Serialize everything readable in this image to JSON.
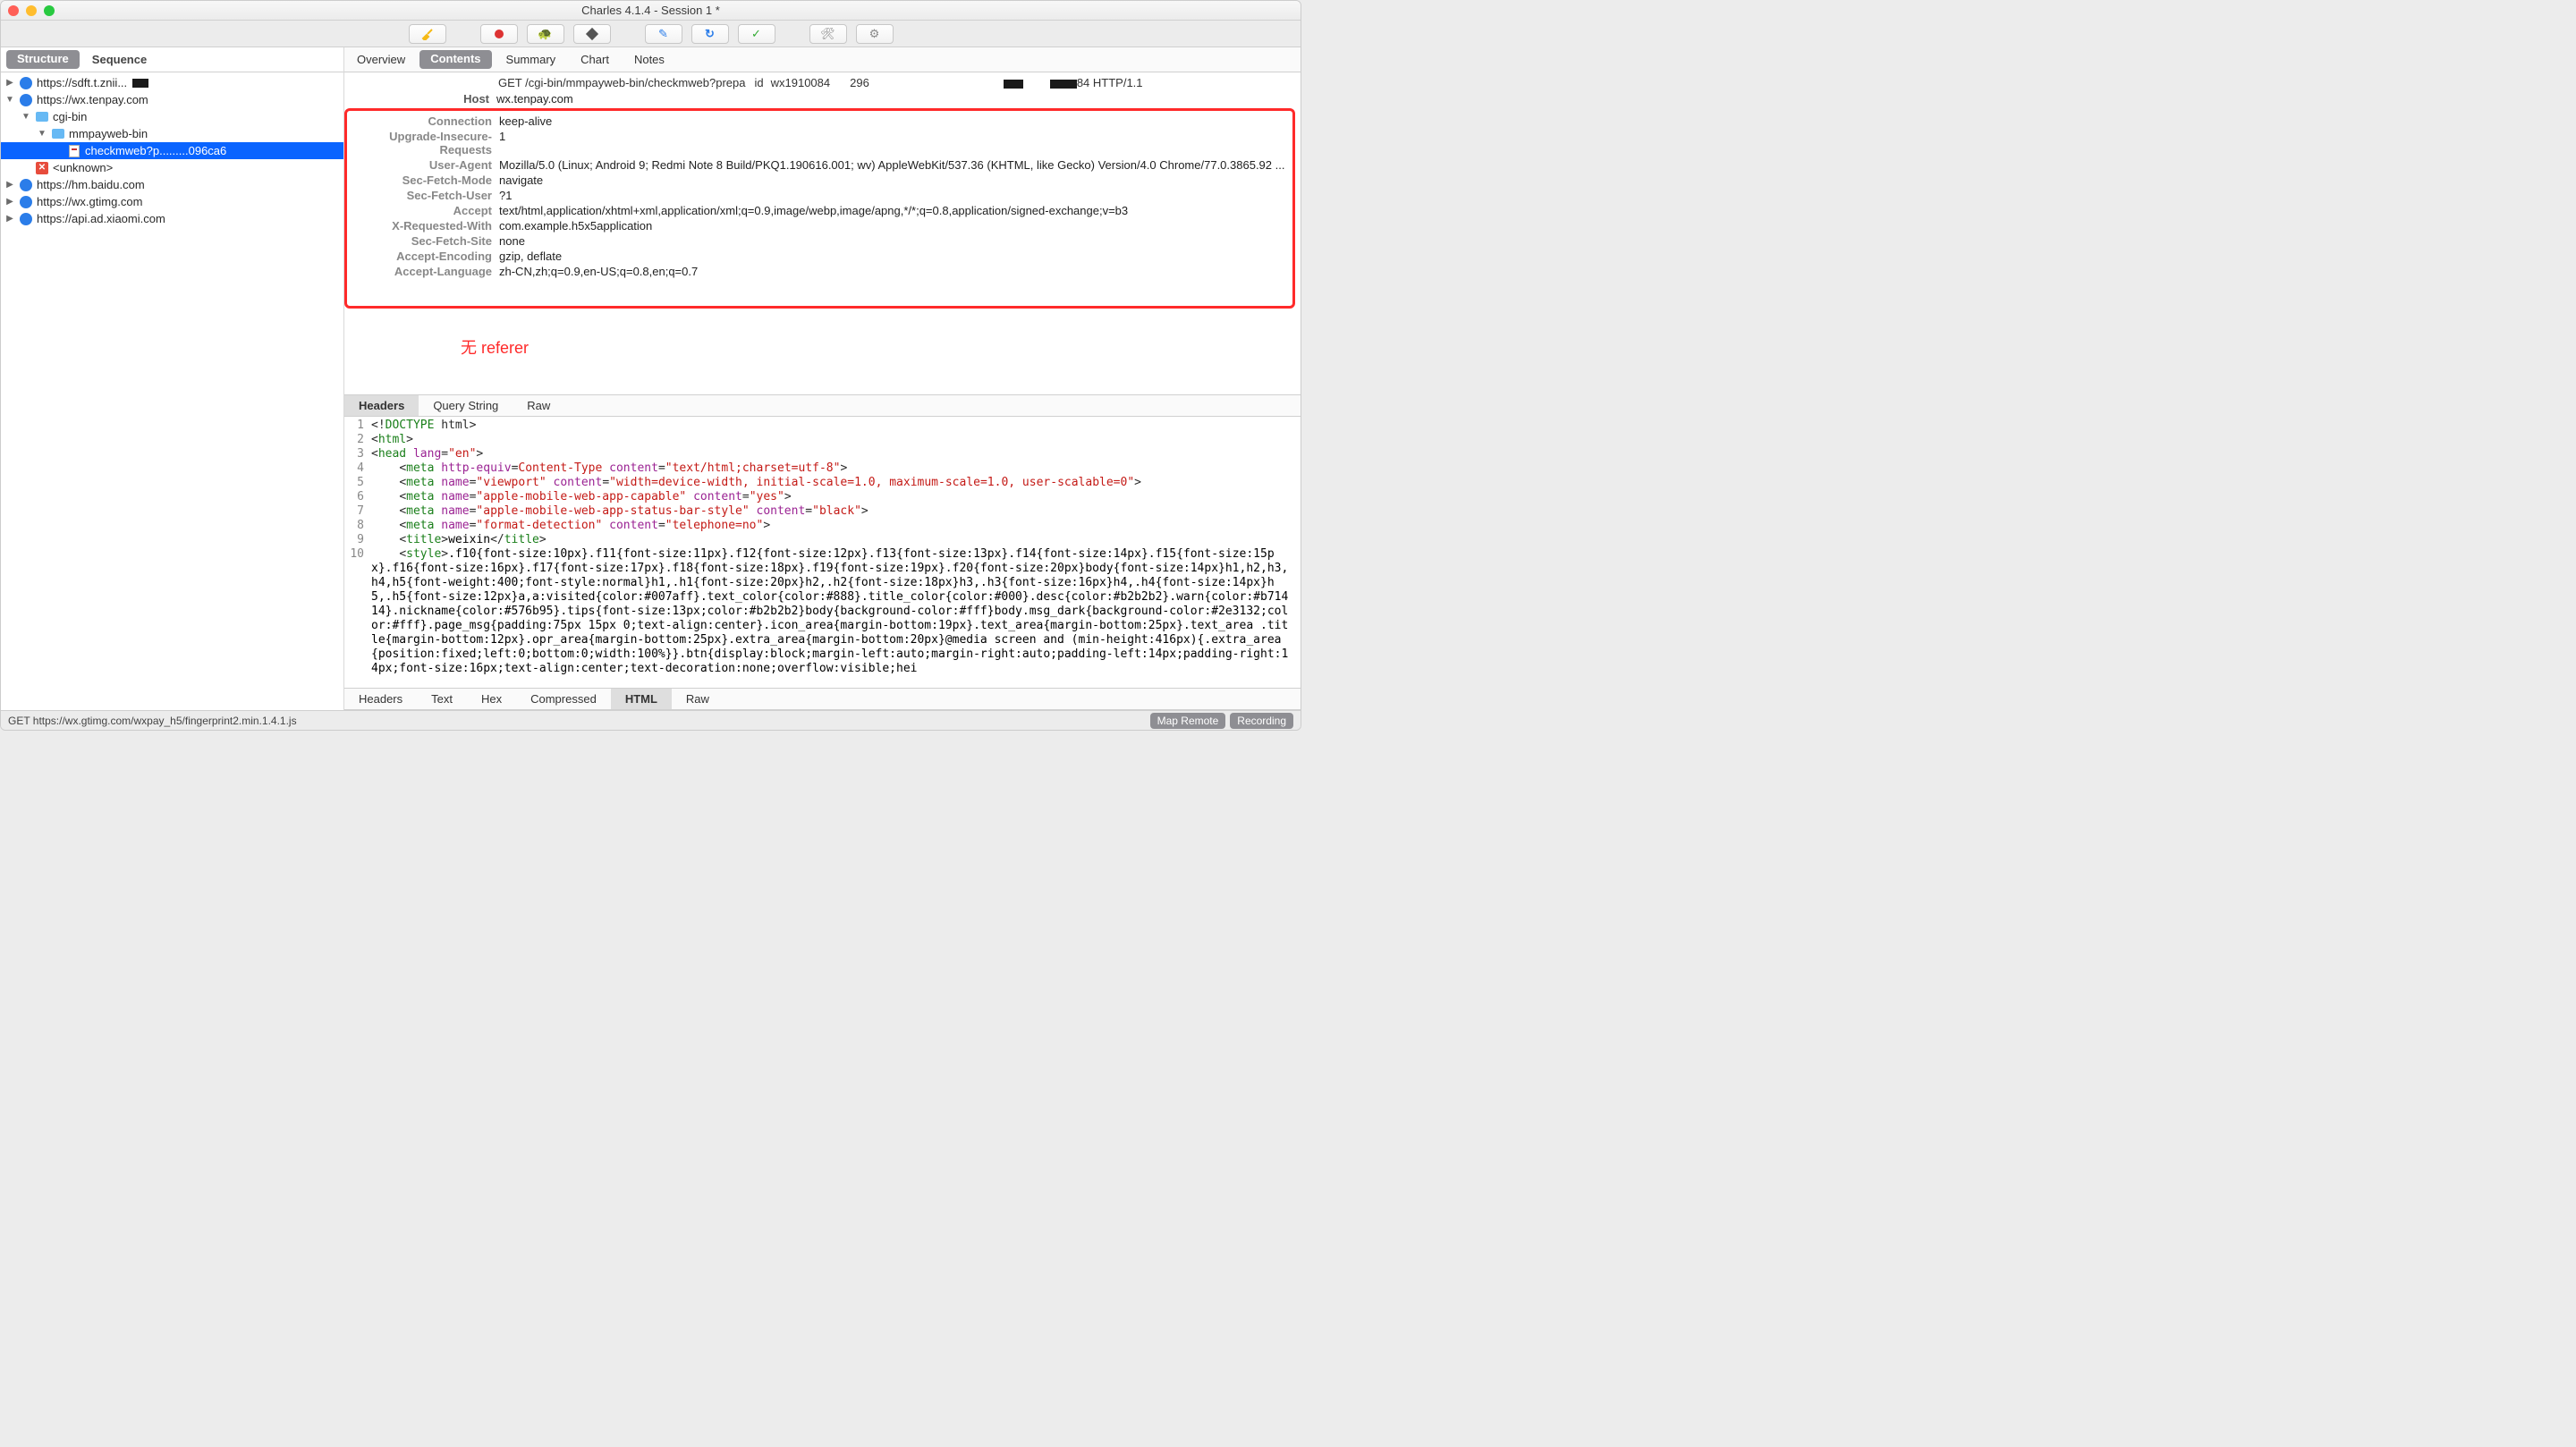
{
  "window": {
    "title": "Charles 4.1.4 - Session 1 *"
  },
  "toolbar_icons": [
    "broom",
    "record",
    "cloud",
    "hex",
    "pencil",
    "refresh",
    "check",
    "wrench",
    "gear"
  ],
  "sidebar": {
    "tabs": {
      "structure": "Structure",
      "sequence": "Sequence"
    },
    "tree": [
      {
        "depth": 0,
        "disc": "▶",
        "icon": "globe-bolt",
        "label": "https://sdft.t.znii..."
      },
      {
        "depth": 0,
        "disc": "▼",
        "icon": "globe",
        "label": "https://wx.tenpay.com"
      },
      {
        "depth": 1,
        "disc": "▼",
        "icon": "folder",
        "label": "cgi-bin"
      },
      {
        "depth": 2,
        "disc": "▼",
        "icon": "folder",
        "label": "mmpayweb-bin"
      },
      {
        "depth": 3,
        "disc": "",
        "icon": "doc",
        "label": "checkmweb?p.........096ca6",
        "sel": true
      },
      {
        "depth": 1,
        "disc": "",
        "icon": "xbox",
        "label": "<unknown>"
      },
      {
        "depth": 0,
        "disc": "▶",
        "icon": "globe",
        "label": "https://hm.baidu.com"
      },
      {
        "depth": 0,
        "disc": "▶",
        "icon": "globe",
        "label": "https://wx.gtimg.com"
      },
      {
        "depth": 0,
        "disc": "▶",
        "icon": "globe",
        "label": "https://api.ad.xiaomi.com"
      }
    ]
  },
  "main": {
    "tabs": [
      "Overview",
      "Contents",
      "Summary",
      "Chart",
      "Notes"
    ],
    "active_tab": "Contents",
    "request_line_prefix": "GET /cgi-bin/mmpayweb-bin/checkmweb?prepa",
    "request_line_suffix": "84 HTTP/1.1",
    "host_label": "Host",
    "host_value": "wx.tenpay.com",
    "headers": [
      {
        "name": "Connection",
        "value": "keep-alive"
      },
      {
        "name": "Upgrade-Insecure-Requests",
        "value": "1"
      },
      {
        "name": "User-Agent",
        "value": "Mozilla/5.0 (Linux; Android 9; Redmi Note 8 Build/PKQ1.190616.001; wv) AppleWebKit/537.36 (KHTML, like Gecko) Version/4.0 Chrome/77.0.3865.92 ..."
      },
      {
        "name": "Sec-Fetch-Mode",
        "value": "navigate"
      },
      {
        "name": "Sec-Fetch-User",
        "value": "?1"
      },
      {
        "name": "Accept",
        "value": "text/html,application/xhtml+xml,application/xml;q=0.9,image/webp,image/apng,*/*;q=0.8,application/signed-exchange;v=b3"
      },
      {
        "name": "X-Requested-With",
        "value": "com.example.h5x5application"
      },
      {
        "name": "Sec-Fetch-Site",
        "value": "none"
      },
      {
        "name": "Accept-Encoding",
        "value": "gzip, deflate"
      },
      {
        "name": "Accept-Language",
        "value": "zh-CN,zh;q=0.9,en-US;q=0.8,en;q=0.7"
      }
    ],
    "annotation": "无 referer",
    "req_subtabs": [
      "Headers",
      "Query String",
      "Raw"
    ],
    "req_subtab_active": "Headers",
    "resp_subtabs": [
      "Headers",
      "Text",
      "Hex",
      "Compressed",
      "HTML",
      "Raw"
    ],
    "resp_subtab_active": "HTML",
    "html_lines": [
      "<!DOCTYPE html>",
      "<html>",
      "<head lang=\"en\">",
      "    <meta http-equiv=Content-Type content=\"text/html;charset=utf-8\">",
      "    <meta name=\"viewport\" content=\"width=device-width, initial-scale=1.0, maximum-scale=1.0, user-scalable=0\">",
      "    <meta name=\"apple-mobile-web-app-capable\" content=\"yes\">",
      "    <meta name=\"apple-mobile-web-app-status-bar-style\" content=\"black\">",
      "    <meta name=\"format-detection\" content=\"telephone=no\">",
      "    <title>weixin</title>",
      "    <style>.f10{font-size:10px}.f11{font-size:11px}.f12{font-size:12px}.f13{font-size:13px}.f14{font-size:14px}.f15{font-size:15px}.f16{font-size:16px}.f17{font-size:17px}.f18{font-size:18px}.f19{font-size:19px}.f20{font-size:20px}body{font-size:14px}h1,h2,h3,h4,h5{font-weight:400;font-style:normal}h1,.h1{font-size:20px}h2,.h2{font-size:18px}h3,.h3{font-size:16px}h4,.h4{font-size:14px}h5,.h5{font-size:12px}a,a:visited{color:#007aff}.text_color{color:#888}.title_color{color:#000}.desc{color:#b2b2b2}.warn{color:#b71414}.nickname{color:#576b95}.tips{font-size:13px;color:#b2b2b2}body{background-color:#fff}body.msg_dark{background-color:#2e3132;color:#fff}.page_msg{padding:75px 15px 0;text-align:center}.icon_area{margin-bottom:19px}.text_area{margin-bottom:25px}.text_area .title{margin-bottom:12px}.opr_area{margin-bottom:25px}.extra_area{margin-bottom:20px}@media screen and (min-height:416px){.extra_area{position:fixed;left:0;bottom:0;width:100%}}.btn{display:block;margin-left:auto;margin-right:auto;padding-left:14px;padding-right:14px;font-size:16px;text-align:center;text-decoration:none;overflow:visible;hei"
    ]
  },
  "status": {
    "left": "GET https://wx.gtimg.com/wxpay_h5/fingerprint2.min.1.4.1.js",
    "map_remote": "Map Remote",
    "recording": "Recording"
  }
}
